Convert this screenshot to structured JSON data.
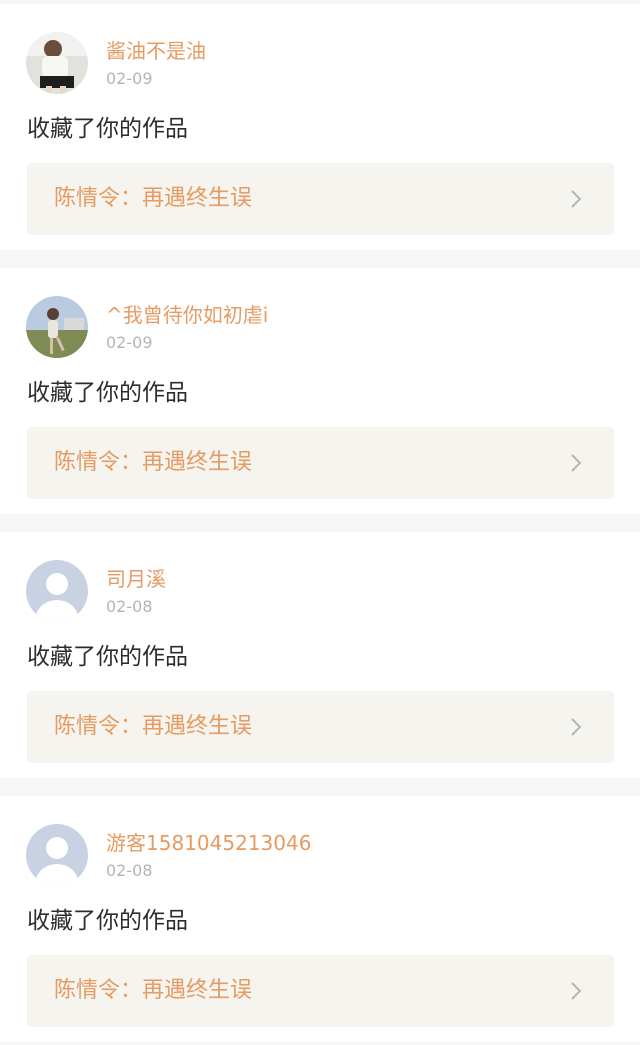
{
  "notifications": [
    {
      "username": "酱油不是油",
      "date": "02-09",
      "action": "收藏了你的作品",
      "work_title": "陈情令：再遇终生误",
      "avatar": "photo-girl-icon"
    },
    {
      "username": "^我曾待你如初虐i",
      "date": "02-09",
      "action": "收藏了你的作品",
      "work_title": "陈情令：再遇终生误",
      "avatar": "photo-outdoor-icon"
    },
    {
      "username": "司月溪",
      "date": "02-08",
      "action": "收藏了你的作品",
      "work_title": "陈情令：再遇终生误",
      "avatar": "default-user-icon"
    },
    {
      "username": "游客1581045213046",
      "date": "02-08",
      "action": "收藏了你的作品",
      "work_title": "陈情令：再遇终生误",
      "avatar": "default-user-icon"
    }
  ],
  "colors": {
    "accent": "#e59b62",
    "date": "#b4b4b4",
    "link_bg": "#f5f4ef",
    "page_bg": "#f7f6f5"
  },
  "icons": {
    "chevron": "chevron-right-icon"
  }
}
